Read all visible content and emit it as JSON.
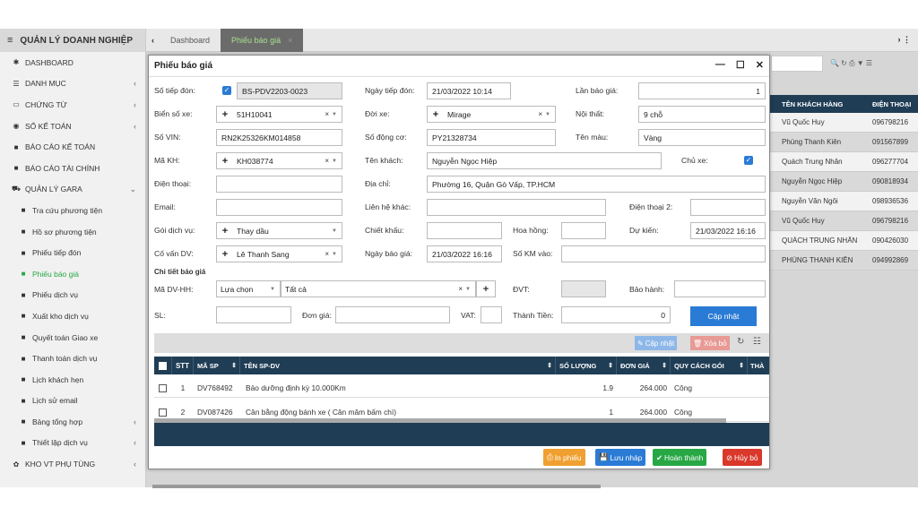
{
  "sidebar": {
    "title": "QUẢN LÝ DOANH NGHIỆP",
    "items": [
      {
        "label": "DASHBOARD",
        "icon": "tachometer-icon",
        "chevron": false
      },
      {
        "label": "DANH MỤC",
        "icon": "list-icon",
        "chevron": true
      },
      {
        "label": "CHỨNG TỪ",
        "icon": "laptop-icon",
        "chevron": true
      },
      {
        "label": "SỔ KẾ TOÁN",
        "icon": "circle-dot-icon",
        "chevron": true
      },
      {
        "label": "BÁO CÁO KẾ TOÁN",
        "icon": "folder-icon",
        "chevron": false
      },
      {
        "label": "BÁO CÁO TÀI CHÍNH",
        "icon": "folder-icon",
        "chevron": false
      },
      {
        "label": "QUẢN LÝ GARA",
        "icon": "car-icon",
        "chevron": true
      }
    ],
    "sub_items": [
      {
        "label": "Tra cứu phương tiện",
        "active": false
      },
      {
        "label": "Hồ sơ phương tiện",
        "active": false
      },
      {
        "label": "Phiếu tiếp đón",
        "active": false
      },
      {
        "label": "Phiếu báo giá",
        "active": true
      },
      {
        "label": "Phiếu dịch vụ",
        "active": false
      },
      {
        "label": "Xuất kho dịch vụ",
        "active": false
      },
      {
        "label": "Quyết toán Giao xe",
        "active": false
      },
      {
        "label": "Thanh toán dịch vụ",
        "active": false
      },
      {
        "label": "Lịch khách hẹn",
        "active": false
      },
      {
        "label": "Lịch sử email",
        "active": false
      },
      {
        "label": "Bảng tổng hợp",
        "active": false,
        "chevron": true
      },
      {
        "label": "Thiết lập dịch vụ",
        "active": false,
        "chevron": true
      }
    ],
    "last_item": {
      "label": "KHO VT PHỤ TÙNG",
      "icon": "cogs-icon"
    }
  },
  "tabs": [
    {
      "label": "Dashboard",
      "active": false
    },
    {
      "label": "Phiếu báo giá",
      "active": true
    }
  ],
  "background_table": {
    "headers": [
      "TÊN KHÁCH HÀNG",
      "ĐIỆN THOẠI"
    ],
    "rows": [
      [
        "Vũ Quốc Huy",
        "096798216"
      ],
      [
        "Phùng Thanh Kiên",
        "091567899"
      ],
      [
        "Quách Trung Nhân",
        "096277704"
      ],
      [
        "Nguyễn Ngọc Hiệp",
        "090818934"
      ],
      [
        "Nguyễn Văn Ngôi",
        "098936536"
      ],
      [
        "Vũ Quốc Huy",
        "096798216"
      ],
      [
        "QUÁCH TRUNG NHÂN",
        "090426030"
      ],
      [
        "PHÙNG THANH KIÊN",
        "094992869"
      ]
    ]
  },
  "modal": {
    "title": "Phiếu báo giá",
    "labels": {
      "so_tiep_don": "Số tiếp đón:",
      "ngay_tiep_don": "Ngày tiếp đón:",
      "lan_bao_gia": "Lần báo giá:",
      "bien_so_xe": "Biển số xe:",
      "doi_xe": "Đời xe:",
      "noi_that": "Nội thất:",
      "so_vin": "Số VIN:",
      "so_dong_co": "Số động cơ:",
      "ten_mau": "Tên màu:",
      "ma_kh": "Mã KH:",
      "ten_khach": "Tên khách:",
      "chu_xe": "Chủ xe:",
      "dien_thoai": "Điện thoại:",
      "dia_chi": "Địa chỉ:",
      "email": "Email:",
      "lien_he_khac": "Liên hệ khác:",
      "dien_thoai_2": "Điện thoại 2:",
      "goi_dich_vu": "Gói dịch vụ:",
      "chiet_khau": "Chiết khấu:",
      "hoa_hong": "Hoa hồng:",
      "du_kien": "Dự kiến:",
      "co_van_dv": "Cố vấn DV:",
      "ngay_bao_gia": "Ngày báo giá:",
      "so_km_vao": "Số KM vào:",
      "chi_tiet": "Chi tiết báo giá",
      "ma_dv_hh": "Mã DV-HH:",
      "dvt": "ĐVT:",
      "bao_hanh": "Bảo hành:",
      "sl": "SL:",
      "don_gia": "Đơn giá:",
      "vat": "VAT:",
      "thanh_tien": "Thành Tiền:"
    },
    "values": {
      "so_tiep_don": "BS-PDV2203-0023",
      "ngay_tiep_don": "21/03/2022 10:14",
      "lan_bao_gia": "1",
      "bien_so_xe": "51H10041",
      "doi_xe": "Mirage",
      "noi_that": "9 chỗ",
      "so_vin": "RN2K25326KM014858",
      "so_dong_co": "PY21328734",
      "ten_mau": "Vàng",
      "ma_kh": "KH038774",
      "ten_khach": "Nguyễn Ngọc Hiệp",
      "chu_xe_checked": true,
      "dien_thoai": "",
      "dia_chi": "Phường 16, Quận Gò Vấp, TP.HCM",
      "email": "",
      "lien_he_khac": "",
      "dien_thoai_2": "",
      "goi_dich_vu": "Thay dầu",
      "chiet_khau": "",
      "hoa_hong": "",
      "du_kien": "21/03/2022 16:16",
      "co_van_dv": "Lê Thanh Sang",
      "ngay_bao_gia": "21/03/2022 16:16",
      "so_km_vao": "",
      "ma_dv_type": "Lựa chọn",
      "ma_dv_value": "Tất cả",
      "thanh_tien": "0"
    },
    "update_button": "Cập nhật",
    "table_toolbar": {
      "update": "Cập nhật",
      "delete": "Xóa bỏ"
    },
    "table": {
      "headers": [
        "STT",
        "MÃ SP",
        "TÊN SP-DV",
        "SỐ LƯỢNG",
        "ĐƠN GIÁ",
        "QUY CÁCH GÓI",
        "THÀ"
      ],
      "rows": [
        {
          "stt": "1",
          "ma_sp": "DV768492",
          "ten": "Bảo dưỡng định kỳ 10.000Km",
          "so_luong": "1.9",
          "don_gia": "264.000",
          "quy_cach": "Công"
        },
        {
          "stt": "2",
          "ma_sp": "DV087426",
          "ten": "Cân bằng động bánh xe ( Cân mâm bấm chì)",
          "so_luong": "1",
          "don_gia": "264.000",
          "quy_cach": "Công"
        }
      ]
    },
    "footer_buttons": {
      "print": "In phiếu",
      "save_draft": "Lưu nháp",
      "complete": "Hoàn thành",
      "cancel": "Hủy bỏ"
    }
  },
  "colors": {
    "header_navy": "#1f3d55",
    "accent_blue": "#2a7bd5",
    "active_green": "#28a745",
    "print_orange": "#f0a030",
    "draft_blue": "#2a7bd5",
    "complete_green": "#28a745",
    "cancel_red": "#d9382b"
  }
}
